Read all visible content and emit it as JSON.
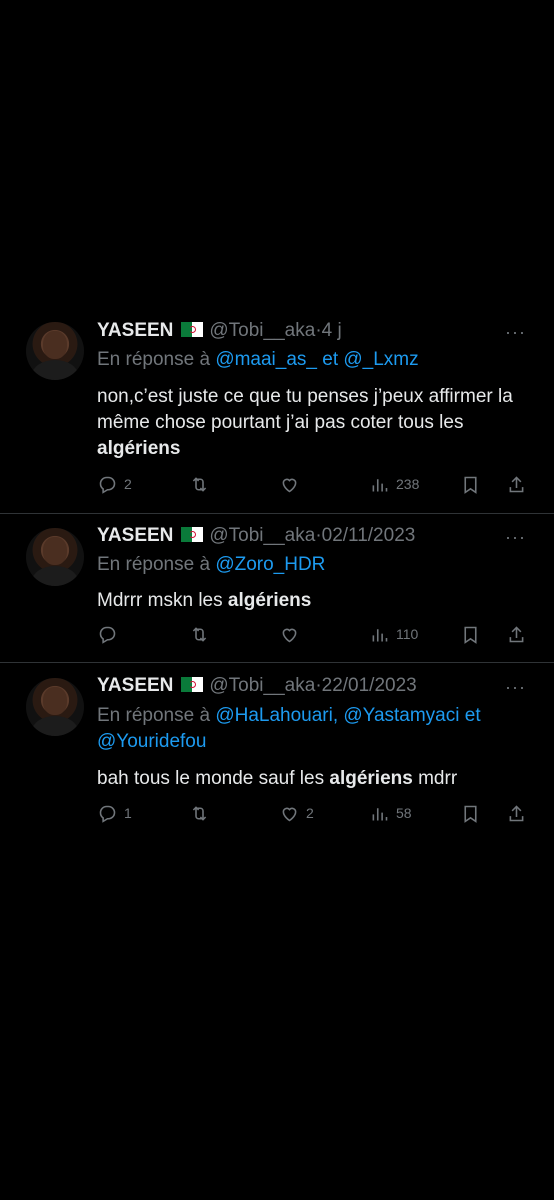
{
  "tweets": [
    {
      "name": "YASEEN",
      "handle": "@Tobi__aka",
      "dot": "·",
      "date": "4 j",
      "reply_prefix": "En réponse à",
      "reply_mentions": "@maai_as_ et @_Lxmz",
      "text_plain": "non,c’est juste ce que tu penses j’peux affirmer la même chose pourtant j’ai pas coter tous les",
      "text_bold": "algériens",
      "text_after": "",
      "reply_count": "2",
      "retweet_count": "",
      "like_count": "",
      "views_count": "238"
    },
    {
      "name": "YASEEN",
      "handle": "@Tobi__aka",
      "dot": "·",
      "date": "02/11/2023",
      "reply_prefix": "En réponse à",
      "reply_mentions": "@Zoro_HDR",
      "text_plain": "Mdrrr mskn les",
      "text_bold": "algériens",
      "text_after": "",
      "reply_count": "",
      "retweet_count": "",
      "like_count": "",
      "views_count": "110"
    },
    {
      "name": "YASEEN",
      "handle": "@Tobi__aka",
      "dot": "·",
      "date": "22/01/2023",
      "reply_prefix": "En réponse à",
      "reply_mentions": "@HaLahouari, @Yastamyaci et @Youridefou",
      "text_plain": "bah tous le monde sauf les",
      "text_bold": "algériens",
      "text_after": "mdrr",
      "reply_count": "1",
      "retweet_count": "",
      "like_count": "2",
      "views_count": "58"
    }
  ],
  "more_label": "···",
  "icons": {
    "reply": "reply-icon",
    "retweet": "retweet-icon",
    "like": "like-icon",
    "views": "views-icon",
    "bookmark": "bookmark-icon",
    "share": "share-icon",
    "flag": "algeria-flag-icon"
  }
}
